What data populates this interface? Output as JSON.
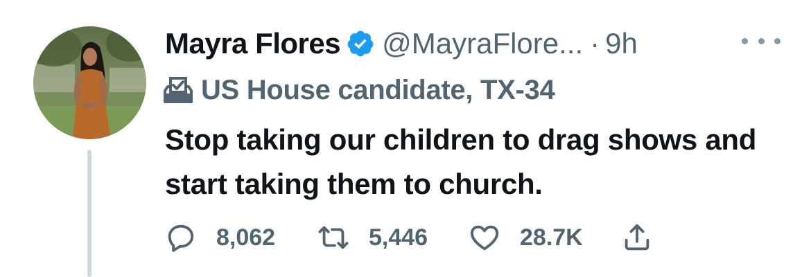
{
  "tweet": {
    "display_name": "Mayra Flores",
    "handle": "@MayraFlore...",
    "separator": "·",
    "time": "9h",
    "label": "US House candidate, TX-34",
    "text": "Stop taking our children to drag shows and start taking them to church.",
    "stats": {
      "replies": "8,062",
      "retweets": "5,446",
      "likes": "28.7K"
    }
  },
  "colors": {
    "primary_text": "#0f1419",
    "secondary_text": "#536471",
    "verified_badge": "#1d9bf0",
    "thread_line": "#cfd9de"
  },
  "icons": {
    "verified": "verified-badge-icon",
    "label": "ballot-box-icon",
    "more": "more-dots-icon",
    "reply": "reply-bubble-icon",
    "retweet": "retweet-arrows-icon",
    "like": "heart-icon",
    "share": "share-upload-icon"
  }
}
